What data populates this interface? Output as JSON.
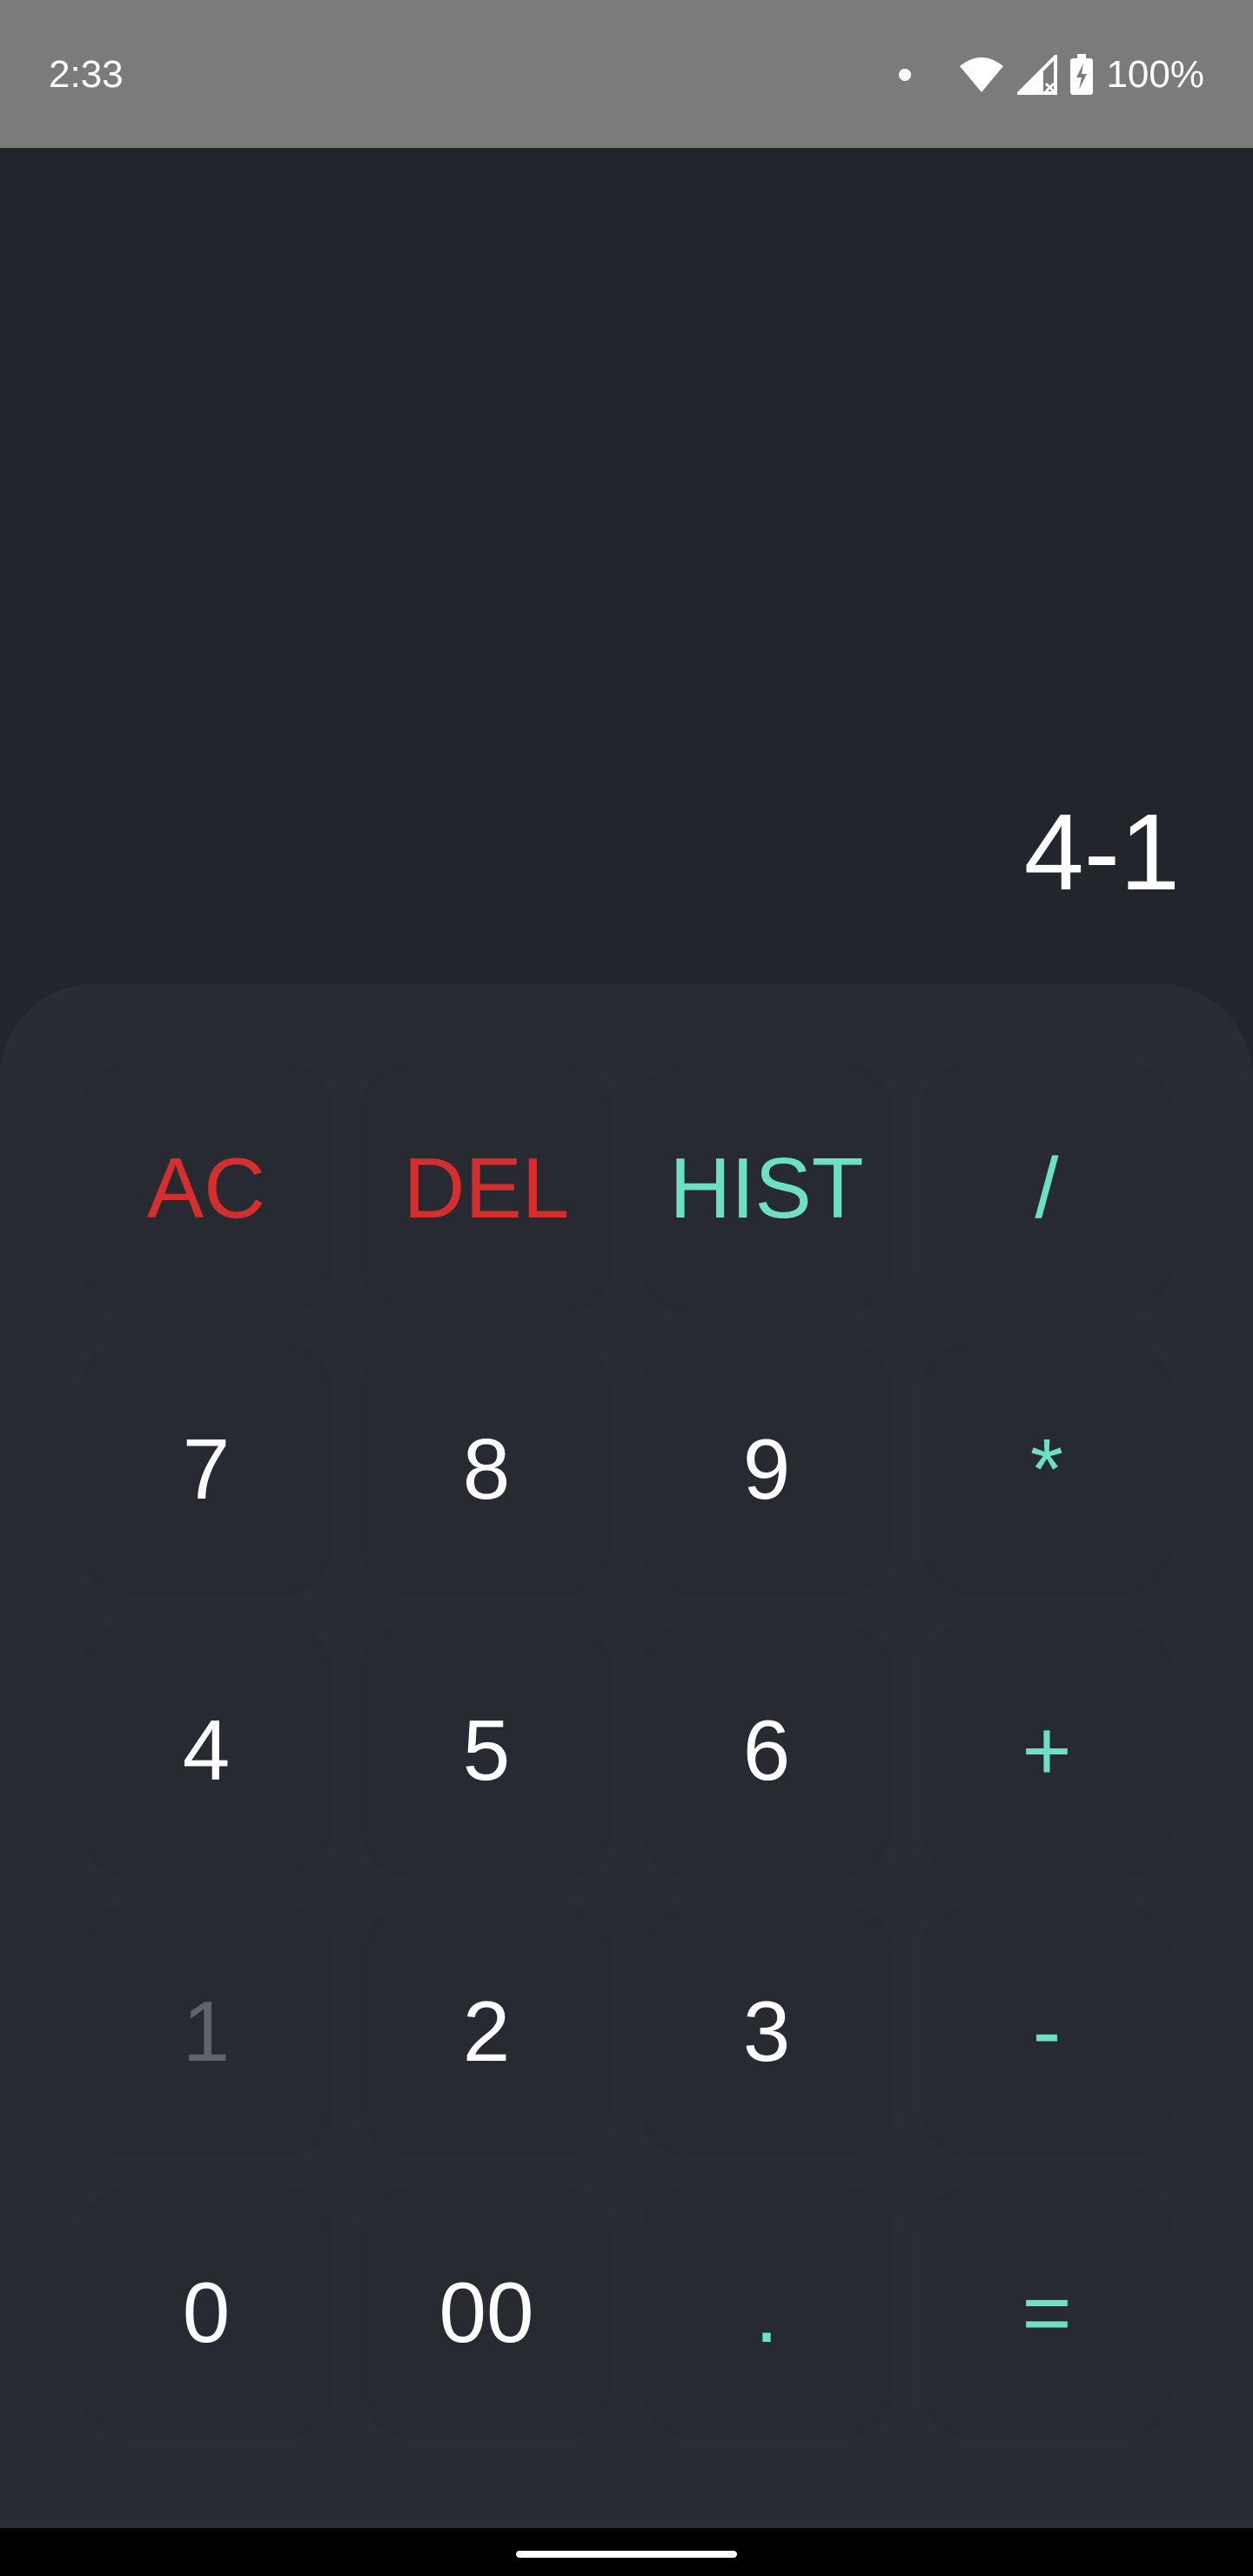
{
  "status_bar": {
    "time": "2:33",
    "battery": "100%",
    "icons": [
      "notification-dot-icon",
      "wifi-icon",
      "cell-signal-icon",
      "battery-charging-icon"
    ]
  },
  "display": {
    "expression": "4-1"
  },
  "keypad": {
    "row1": [
      "AC",
      "DEL",
      "HIST",
      "/"
    ],
    "row2": [
      "7",
      "8",
      "9",
      "*"
    ],
    "row3": [
      "4",
      "5",
      "6",
      "+"
    ],
    "row4": [
      "1",
      "2",
      "3",
      "-"
    ],
    "row5": [
      "0",
      "00",
      ".",
      "="
    ]
  },
  "colors": {
    "background": "#22252c",
    "keypad_panel": "#292c33",
    "key": "#272a31",
    "clear_accent": "#d32f2f",
    "operator_accent": "#6ddfc5"
  }
}
